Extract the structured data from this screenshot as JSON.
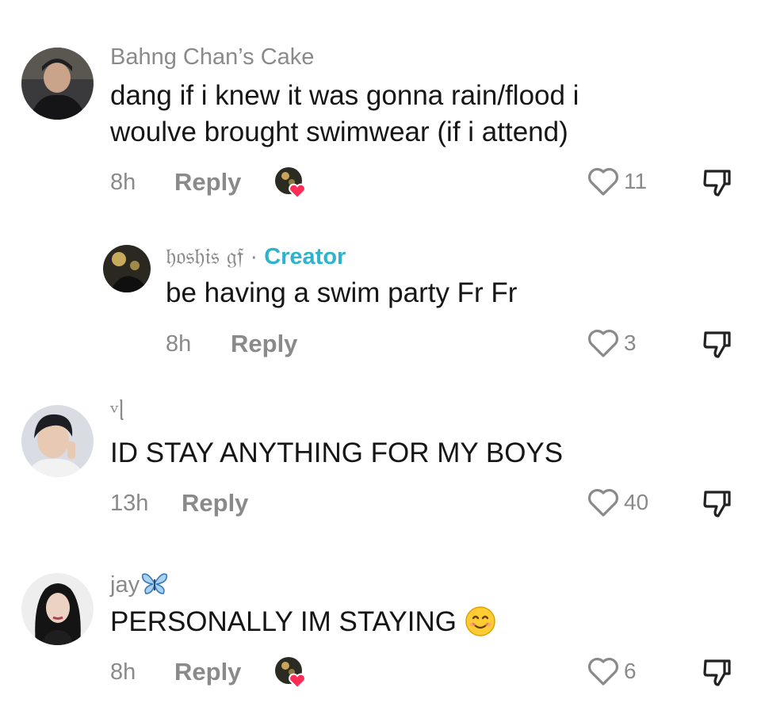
{
  "comments": [
    {
      "username": "Bahng Chan’s Cake",
      "text_lines": [
        "dang if i knew it was gonna rain/flood i",
        "woulve brought swimwear (if i attend)"
      ],
      "time": "8h",
      "reply_label": "Reply",
      "likes": "11",
      "liked_by_creator": true
    },
    {
      "username": "𝔥𝔬𝔰𝔥𝔦𝔰 𝔤𝔣",
      "separator": "·",
      "badge": "Creator",
      "text": "be having a swim party Fr Fr",
      "time": "8h",
      "reply_label": "Reply",
      "likes": "3",
      "is_reply": true
    },
    {
      "username": "ᵛᥣ",
      "text": "ID STAY ANYTHING FOR MY BOYS",
      "time": "13h",
      "reply_label": "Reply",
      "likes": "40"
    },
    {
      "username": "jay",
      "username_icon": "butterfly-icon",
      "text": "PERSONALLY IM STAYING",
      "text_emoji": "smiling-face-emoji",
      "time": "8h",
      "reply_label": "Reply",
      "likes": "6",
      "liked_by_creator": true
    }
  ],
  "colors": {
    "username": "#8a8a8a",
    "creator_badge": "#2fb3cc",
    "text": "#161616",
    "heart_badge": "#fe2c55"
  }
}
